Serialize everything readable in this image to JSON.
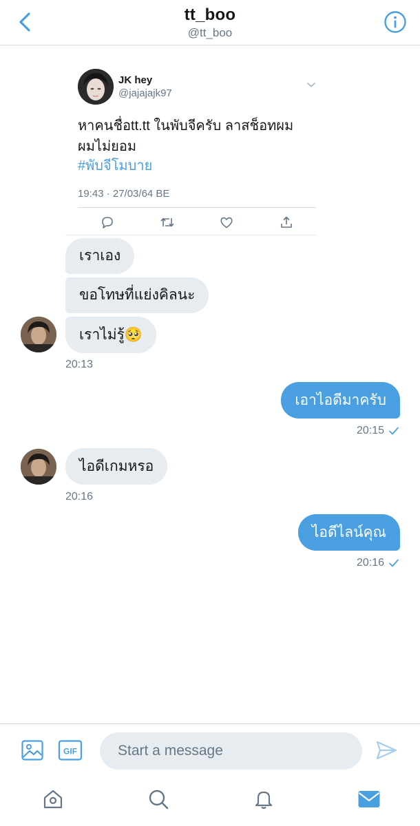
{
  "header": {
    "title": "tt_boo",
    "handle": "@tt_boo",
    "back_icon": "chevron-left-icon",
    "info_icon": "info-icon"
  },
  "colors": {
    "accent": "#4a9fe0",
    "incoming_bubble": "#e6ecf0",
    "secondary_text": "#657786"
  },
  "shared_tweet": {
    "author_name": "JK hey",
    "author_handle": "@jajajajk97",
    "text": "หาคนชื่อtt.tt ในพับจีครับ ลาสช็อทผม ผมไม่ยอม",
    "hashtag": "#พับจีโมบาย",
    "timestamp": "19:43 · 27/03/64 BE"
  },
  "messages": {
    "m1": "เราเอง",
    "m2": "ขอโทษที่แย่งคิลนะ",
    "m3": "เราไม่รู้🥺",
    "t1": "20:13",
    "m4": "เอาไอดีมาครับ",
    "t2": "20:15",
    "m5": "ไอดีเกมหรอ",
    "t3": "20:16",
    "m6": "ไอดีไลน์คุณ",
    "t4": "20:16"
  },
  "composer": {
    "placeholder": "Start a message",
    "gif_label": "GIF"
  },
  "nav": {
    "items": [
      "home-icon",
      "search-icon",
      "notifications-icon",
      "messages-icon"
    ]
  }
}
